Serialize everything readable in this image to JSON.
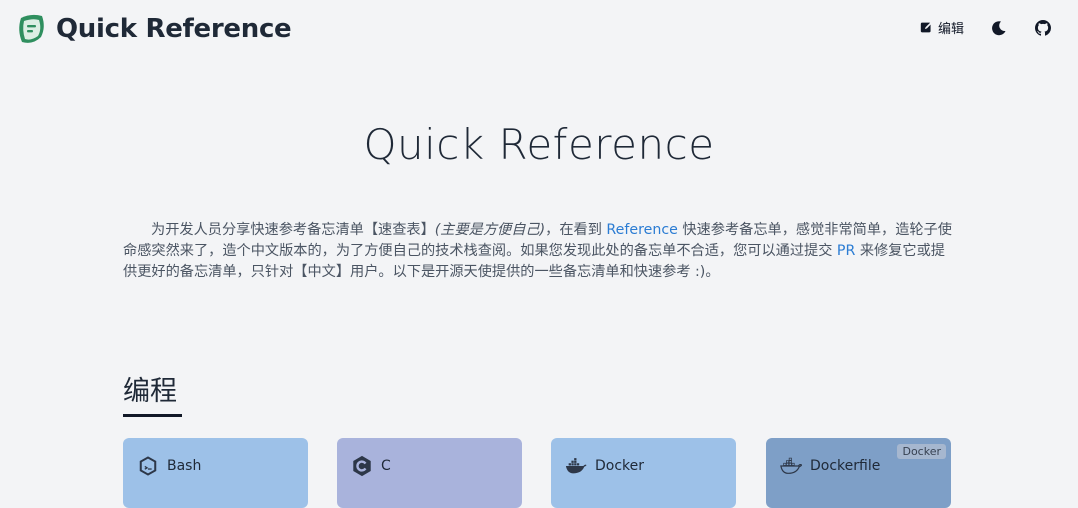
{
  "header": {
    "brand_title": "Quick Reference",
    "edit_label": "编辑",
    "icons": [
      "logo-icon",
      "edit-icon",
      "moon-icon",
      "github-icon"
    ]
  },
  "hero": {
    "title": "Quick Reference"
  },
  "intro": {
    "part1": "为开发人员分享快速参考备忘清单【速查表】",
    "emphasis": "(主要是方便自己)",
    "part2": "，在看到 ",
    "link_reference": "Reference",
    "part3": " 快速参考备忘单，感觉非常简单，造轮子使命感突然来了，造个中文版本的，为了方便自己的技术栈查阅。如果您发现此处的备忘单不合适，您可以通过提交 ",
    "link_pr": "PR",
    "part4": " 来修复它或提供更好的备忘清单，只针对【中文】用户。以下是开源天使提供的一些备忘清单和快速参考 :)。"
  },
  "section": {
    "title": "编程"
  },
  "cards": [
    {
      "label": "Bash",
      "icon": "bash-icon",
      "color": "#9dc1e8"
    },
    {
      "label": "C",
      "icon": "c-icon",
      "color": "#a9b3dc"
    },
    {
      "label": "Docker",
      "icon": "docker-icon",
      "color": "#9dc1e8"
    },
    {
      "label": "Dockerfile",
      "icon": "docker-icon",
      "color": "#7e9fc7",
      "badge": "Docker"
    }
  ],
  "colors": {
    "background": "#f3f4f6",
    "link": "#2b7cd3",
    "logo": "#2f8f5f"
  }
}
